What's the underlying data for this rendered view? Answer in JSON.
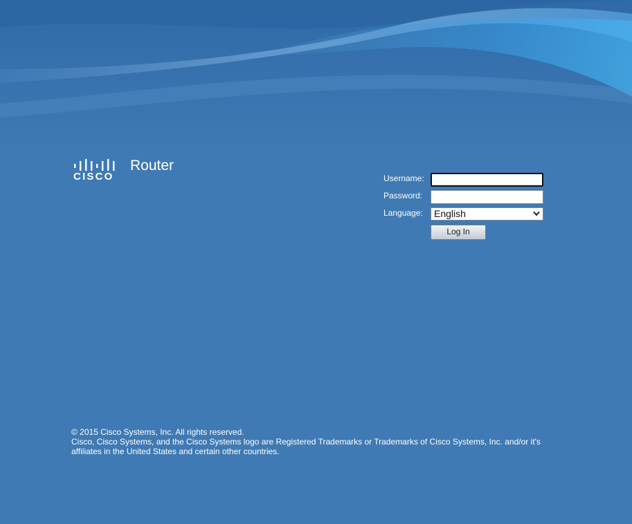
{
  "header": {
    "brand": "CISCO",
    "product_title": "Router"
  },
  "login_form": {
    "username_label": "Username:",
    "username_value": "",
    "password_label": "Password:",
    "password_value": "",
    "language_label": "Language:",
    "language_selected": "English",
    "login_button": "Log In"
  },
  "footer": {
    "copyright": "© 2015 Cisco Systems, Inc. All rights reserved.",
    "trademark": "Cisco, Cisco Systems, and the Cisco Systems logo are Registered Trademarks or Trademarks of Cisco Systems, Inc. and/or it's affiliates in the United States and certain other countries."
  },
  "colors": {
    "background": "#3f7ab4",
    "text": "#ffffff"
  }
}
